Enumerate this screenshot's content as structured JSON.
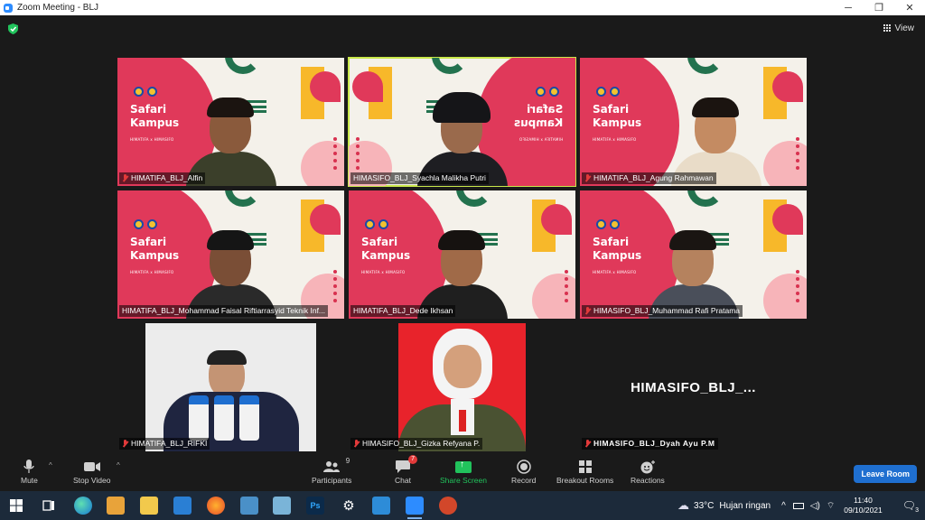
{
  "window": {
    "title": "Zoom Meeting - BLJ",
    "minimize": "─",
    "restore": "❐",
    "close": "✕"
  },
  "view_button": {
    "label": "View"
  },
  "background": {
    "line1": "Safari",
    "line2": "Kampus",
    "sub": "HIMATIFA x HIMASIFO"
  },
  "participants_tiles": [
    {
      "name": "HIMATIFA_BLJ_Alfin",
      "muted": true
    },
    {
      "name": "HIMASIFO_BLJ_Syachla Malikha Putri",
      "muted": false,
      "active_speaker": true
    },
    {
      "name": "HIMATIFA_BLJ_Agung Rahmawan",
      "muted": true
    },
    {
      "name": "HIMATIFA_BLJ_Mohammad Faisal Riftiarrasyid Teknik Inf...",
      "muted": false
    },
    {
      "name": "HIMATIFA_BLJ_Dede Ikhsan",
      "muted": false
    },
    {
      "name": "HIMASIFO_BLJ_Muhammad Rafi Pratama",
      "muted": true
    },
    {
      "name": "HIMATIFA_BLJ_RIFKI",
      "muted": true
    },
    {
      "name": "HIMASIFO_BLJ_Gizka Refyana P.",
      "muted": true
    },
    {
      "name": "HIMASIFO_BLJ_Dyah Ayu P.M",
      "muted": true,
      "video_off_label": "HIMASIFO_BLJ_..."
    }
  ],
  "toolbar": {
    "mute": "Mute",
    "stop_video": "Stop Video",
    "participants": "Participants",
    "participants_count": "9",
    "chat": "Chat",
    "chat_badge": "7",
    "share_screen": "Share Screen",
    "record": "Record",
    "breakout_rooms": "Breakout Rooms",
    "reactions": "Reactions",
    "leave_room": "Leave Room"
  },
  "taskbar": {
    "weather_temp": "33°C",
    "weather_text": "Hujan ringan",
    "time": "11:40",
    "date": "09/10/2021",
    "notification_count": "3"
  }
}
